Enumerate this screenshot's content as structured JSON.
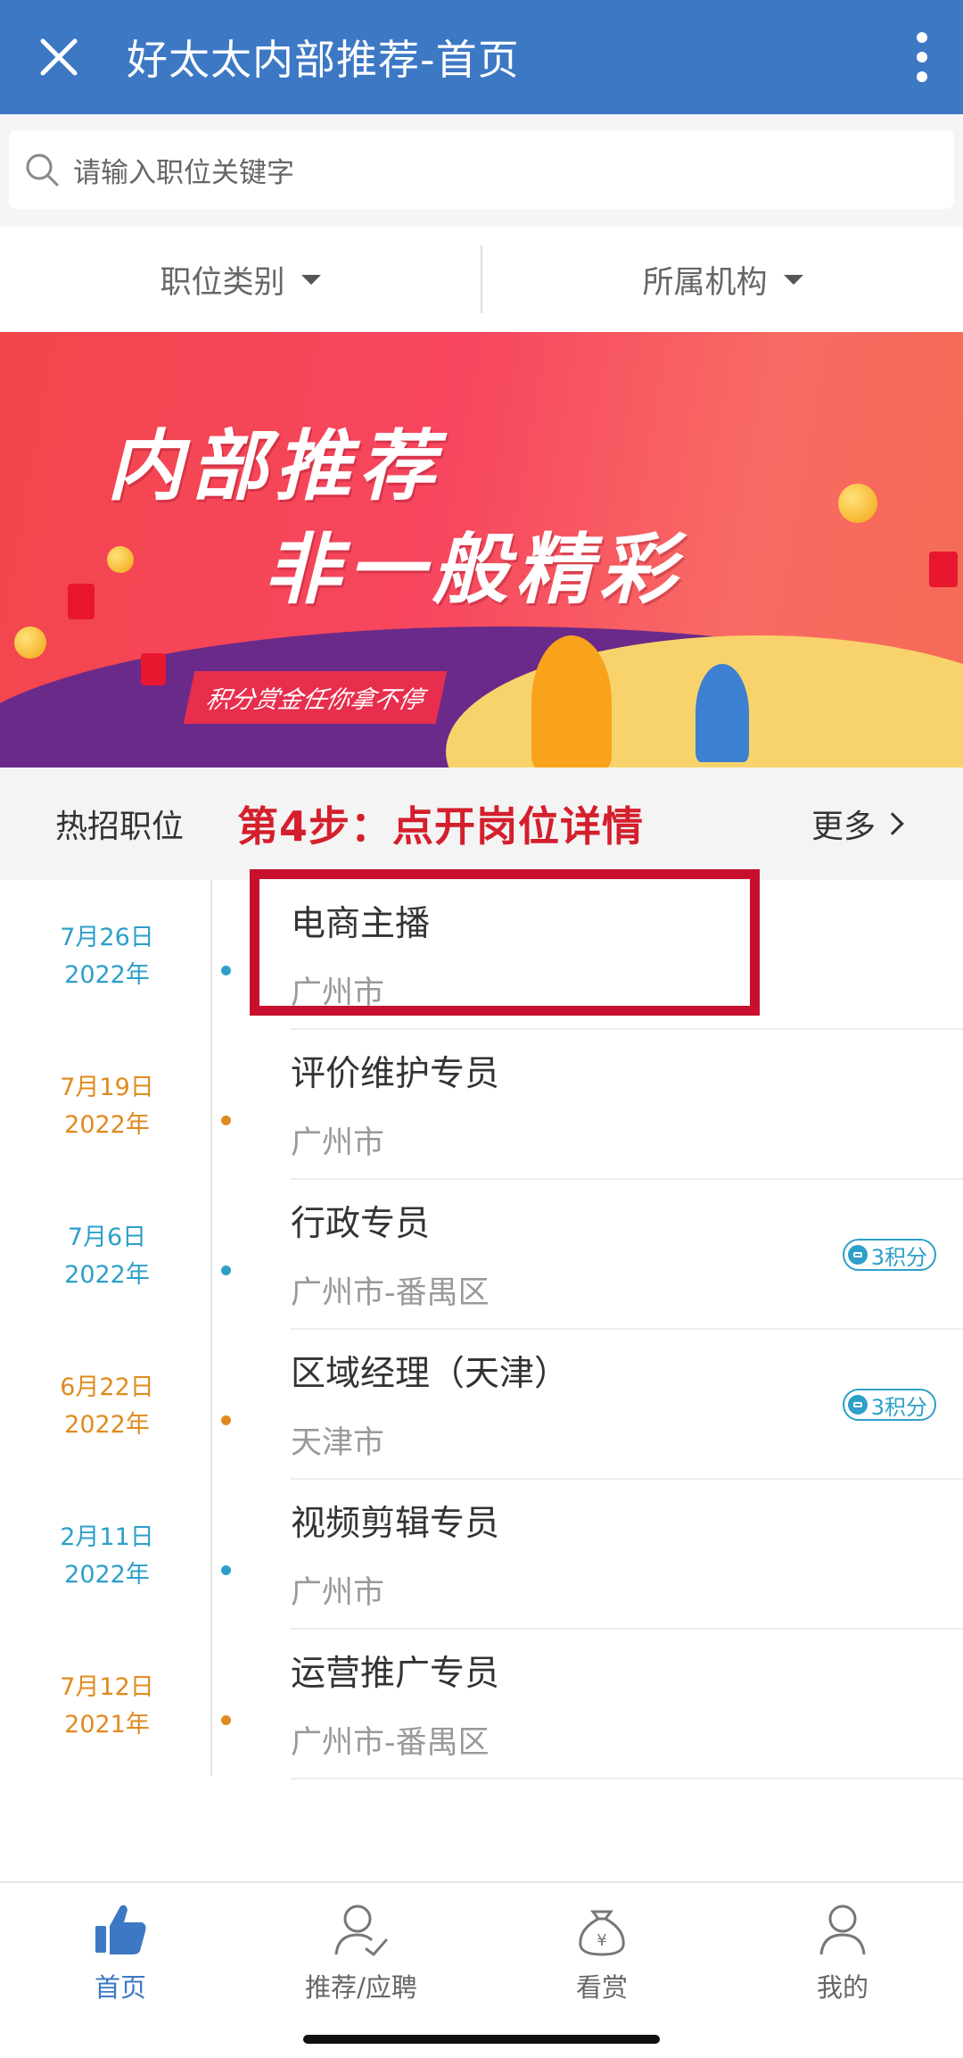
{
  "header": {
    "title": "好太太内部推荐-首页",
    "close_icon": "close-icon",
    "menu_icon": "more-vertical-icon",
    "color": "#3d78c4"
  },
  "search": {
    "placeholder": "请输入职位关键字"
  },
  "filters": [
    {
      "label": "职位类别"
    },
    {
      "label": "所属机构"
    }
  ],
  "banner": {
    "line1": "内部推荐",
    "line2": "非一般精彩",
    "tagline": "积分赏金任你拿不停"
  },
  "hot_jobs": {
    "label": "热招职位",
    "step_annotation": "第4步：点开岗位详情",
    "more_label": "更多"
  },
  "jobs": [
    {
      "month_day": "7月26日",
      "year": "2022年",
      "title": "电商主播",
      "location": "广州市",
      "accent": "blue",
      "points": ""
    },
    {
      "month_day": "7月19日",
      "year": "2022年",
      "title": "评价维护专员",
      "location": "广州市",
      "accent": "orange",
      "points": ""
    },
    {
      "month_day": "7月6日",
      "year": "2022年",
      "title": "行政专员",
      "location": "广州市-番禺区",
      "accent": "blue",
      "points": "3积分"
    },
    {
      "month_day": "6月22日",
      "year": "2022年",
      "title": "区域经理（天津）",
      "location": "天津市",
      "accent": "orange",
      "points": "3积分"
    },
    {
      "month_day": "2月11日",
      "year": "2022年",
      "title": "视频剪辑专员",
      "location": "广州市",
      "accent": "blue",
      "points": ""
    },
    {
      "month_day": "7月12日",
      "year": "2021年",
      "title": "运营推广专员",
      "location": "广州市-番禺区",
      "accent": "orange",
      "points": ""
    }
  ],
  "tabs": [
    {
      "label": "首页",
      "icon": "thumbs-up-icon",
      "active": true
    },
    {
      "label": "推荐/应聘",
      "icon": "user-check-icon",
      "active": false
    },
    {
      "label": "看赏",
      "icon": "money-bag-icon",
      "active": false
    },
    {
      "label": "我的",
      "icon": "user-icon",
      "active": false
    }
  ],
  "colors": {
    "accent_blue": "#2d9fc9",
    "accent_orange": "#e08a1e",
    "annotation_red": "#c8102e"
  }
}
